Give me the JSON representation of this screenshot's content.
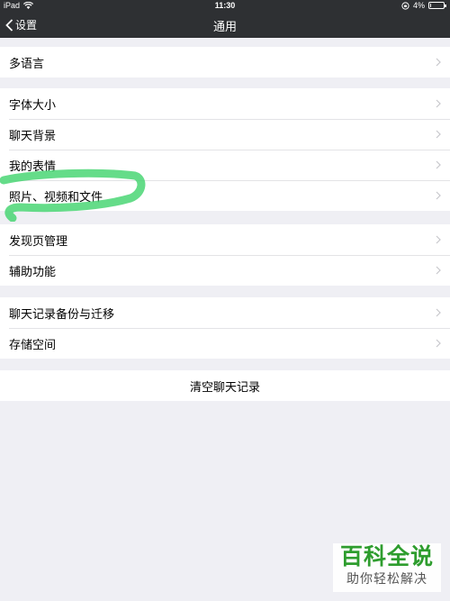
{
  "status_bar": {
    "device": "iPad",
    "time": "11:30",
    "battery_percent": "4%",
    "battery_level": 0.04
  },
  "nav": {
    "back_label": "设置",
    "title": "通用"
  },
  "groups": [
    {
      "items": [
        {
          "label": "多语言"
        }
      ]
    },
    {
      "items": [
        {
          "label": "字体大小"
        },
        {
          "label": "聊天背景"
        },
        {
          "label": "我的表情"
        },
        {
          "label": "照片、视频和文件"
        }
      ]
    },
    {
      "items": [
        {
          "label": "发现页管理"
        },
        {
          "label": "辅助功能"
        }
      ]
    },
    {
      "items": [
        {
          "label": "聊天记录备份与迁移"
        },
        {
          "label": "存储空间"
        }
      ]
    },
    {
      "items": [
        {
          "label": "清空聊天记录"
        }
      ]
    }
  ],
  "watermark": {
    "main": "百科全说",
    "sub": "助你轻松解决"
  },
  "colors": {
    "nav_bg": "#2e3033",
    "page_bg": "#efeff4",
    "highlight": "#3fd36b",
    "watermark_green": "#2e9d2e"
  }
}
